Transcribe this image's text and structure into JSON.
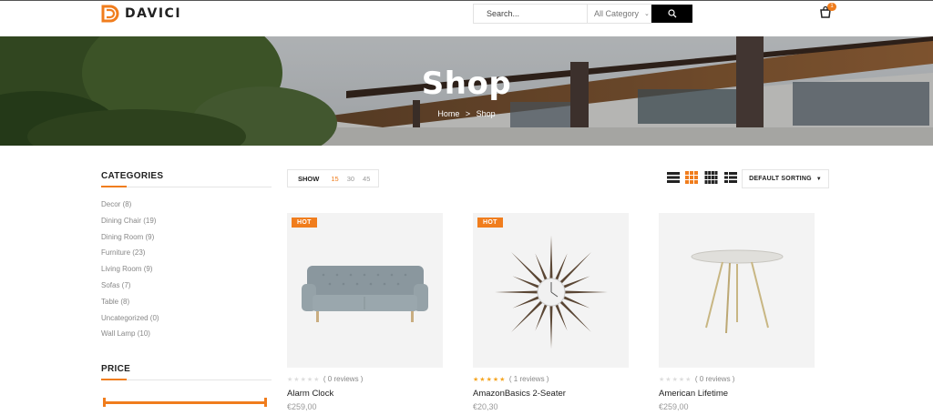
{
  "brand": {
    "name": "DAVICI",
    "accent": "#f07d1d"
  },
  "search": {
    "placeholder": "Search...",
    "category": "All Category",
    "button_icon": "search-icon"
  },
  "cart": {
    "icon": "shopping-bag-icon",
    "count": "1"
  },
  "banner": {
    "title": "Shop",
    "breadcrumb": {
      "home": "Home",
      "separator": ">",
      "current": "Shop"
    }
  },
  "sidebar": {
    "categories_title": "CATEGORIES",
    "categories": [
      {
        "label": "Decor (8)"
      },
      {
        "label": "Dining Chair (19)"
      },
      {
        "label": "Dining Room (9)"
      },
      {
        "label": "Furniture (23)"
      },
      {
        "label": "Living Room (9)"
      },
      {
        "label": "Sofas (7)"
      },
      {
        "label": "Table (8)"
      },
      {
        "label": "Uncategorized (0)"
      },
      {
        "label": "Wall Lamp (10)"
      }
    ],
    "price_title": "PRICE",
    "price_range": {
      "min": 0,
      "max": 1
    }
  },
  "toolbar": {
    "show_label": "SHOW",
    "show_options": [
      "15",
      "30",
      "45"
    ],
    "show_selected": "15",
    "view_modes": [
      "list-view-icon",
      "grid-3-icon",
      "grid-4-icon",
      "list-grid-icon"
    ],
    "active_view": "grid-3-icon",
    "sort_label": "DEFAULT SORTING"
  },
  "products": [
    {
      "name": "Alarm Clock",
      "price": "€259,00",
      "reviews": "( 0 reviews )",
      "rating": 0,
      "badge": "HOT",
      "image": "sofa"
    },
    {
      "name": "AmazonBasics 2-Seater",
      "price": "€20,30",
      "reviews": "( 1 reviews )",
      "rating": 5,
      "badge": "HOT",
      "image": "sunburst-clock"
    },
    {
      "name": "American Lifetime",
      "price": "€259,00",
      "reviews": "( 0 reviews )",
      "rating": 0,
      "badge": "",
      "image": "round-table"
    }
  ]
}
